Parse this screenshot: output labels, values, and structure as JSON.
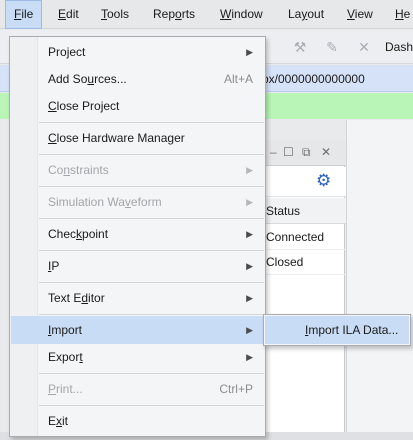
{
  "menubar": {
    "items": [
      {
        "label": "File",
        "u": "F",
        "rest": "ile"
      },
      {
        "label": "Edit",
        "u": "E",
        "rest": "dit"
      },
      {
        "label": "Tools",
        "u": "T",
        "rest": "ools"
      },
      {
        "label": "Reports",
        "pre": "Rep",
        "u": "o",
        "rest": "rts"
      },
      {
        "label": "Window",
        "u": "W",
        "rest": "indow"
      },
      {
        "label": "Layout",
        "pre": "La",
        "u": "y",
        "rest": "out"
      },
      {
        "label": "View",
        "u": "V",
        "rest": "iew"
      },
      {
        "label": "He",
        "u": "H",
        "rest": "e"
      }
    ]
  },
  "toolbar": {
    "dash_label": "Dash"
  },
  "pathbar": {
    "text": "ox/0000000000000"
  },
  "hardware_panel": {
    "column_header": "Status",
    "rows": [
      "Connected",
      "Closed"
    ]
  },
  "file_menu": {
    "project": {
      "pre": "Pro",
      "u": "j",
      "rest": "ect"
    },
    "add_sources": {
      "pre": "Add So",
      "u": "u",
      "rest": "rces...",
      "shortcut": "Alt+A"
    },
    "close_project": {
      "pre": "",
      "u": "C",
      "rest": "lose Project"
    },
    "close_hw_manager": {
      "pre": "",
      "u": "C",
      "rest": "lose Hardware Manager"
    },
    "constraints": {
      "pre": "Co",
      "u": "n",
      "rest": "straints"
    },
    "simulation_waveform": {
      "pre": "Simulation Wa",
      "u": "v",
      "rest": "eform"
    },
    "checkpoint": {
      "pre": "Chec",
      "u": "k",
      "rest": "point"
    },
    "ip": {
      "pre": "",
      "u": "I",
      "rest": "P"
    },
    "text_editor": {
      "pre": "Text E",
      "u": "d",
      "rest": "itor"
    },
    "import": {
      "pre": "",
      "u": "I",
      "rest": "mport"
    },
    "export": {
      "pre": "Expor",
      "u": "t",
      "rest": ""
    },
    "print": {
      "pre": "",
      "u": "P",
      "rest": "rint...",
      "shortcut": "Ctrl+P"
    },
    "exit": {
      "pre": "E",
      "u": "x",
      "rest": "it"
    }
  },
  "import_submenu": {
    "import_ila": {
      "pre": "",
      "u": "I",
      "rest": "mport ILA Data..."
    }
  },
  "icons": {
    "submenu_arrow": "▶",
    "gear": "⚙",
    "panel_minimize": "–",
    "panel_restore": "☐",
    "panel_float": "⧉",
    "panel_close": "✕"
  },
  "colors": {
    "highlight": "#c9dcf5",
    "pathbar": "#d5e2f8",
    "greenbar": "#b9f5b6"
  }
}
